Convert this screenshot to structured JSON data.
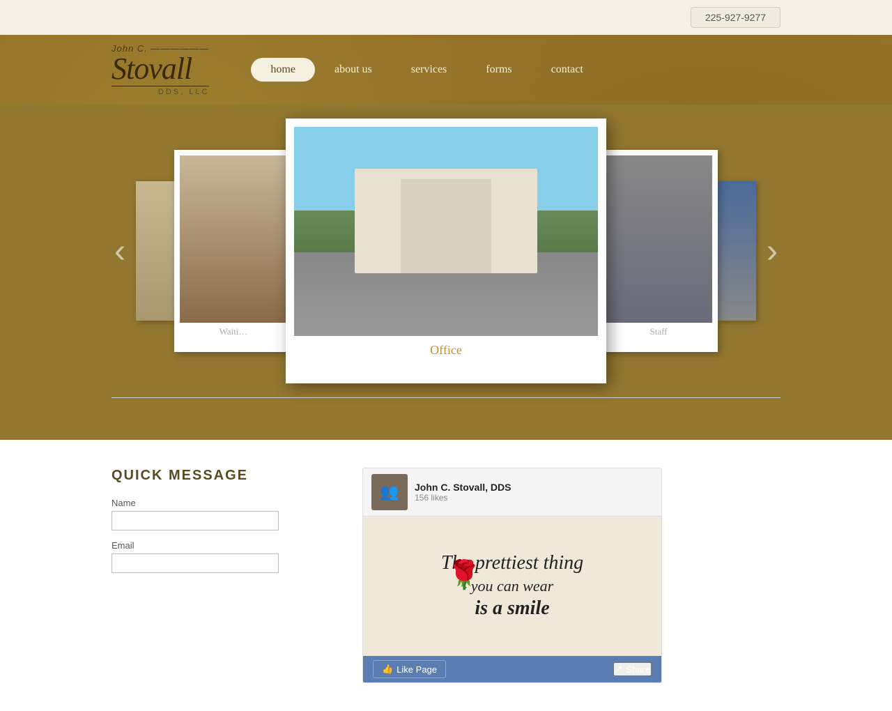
{
  "header": {
    "phone": "225-927-9277",
    "phone_label": "225-927-9277"
  },
  "logo": {
    "john_line": "John C. ——————",
    "stovall": "Stovall",
    "dds": "DDS, LLC"
  },
  "nav": {
    "links": [
      {
        "id": "home",
        "label": "home",
        "active": true
      },
      {
        "id": "about",
        "label": "about us",
        "active": false
      },
      {
        "id": "services",
        "label": "services",
        "active": false
      },
      {
        "id": "forms",
        "label": "forms",
        "active": false
      },
      {
        "id": "contact",
        "label": "contact",
        "active": false
      }
    ]
  },
  "slider": {
    "prev_arrow": "‹",
    "next_arrow": "›",
    "slides": [
      {
        "id": "partial-far-left",
        "caption": ""
      },
      {
        "id": "waiting",
        "caption": "Waiti…"
      },
      {
        "id": "office",
        "caption": "Office",
        "active": true
      },
      {
        "id": "staff",
        "caption": "Staff"
      },
      {
        "id": "partial-far-right",
        "caption": ""
      }
    ]
  },
  "quick_message": {
    "title": "Quick Message",
    "name_label": "Name",
    "email_label": "Email"
  },
  "facebook": {
    "page_name": "John C. Stovall, DDS",
    "likes": "156 likes",
    "quote_line1": "The prettiest thing",
    "quote_line2": "you can wear",
    "quote_line3": "is a smile",
    "like_button": "Like Page",
    "share_button": "Share",
    "like_icon": "👍",
    "share_icon": "↗"
  }
}
